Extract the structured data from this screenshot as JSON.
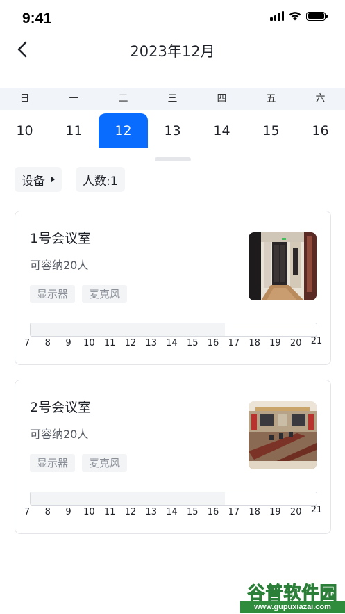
{
  "status_bar": {
    "time": "9:41"
  },
  "header": {
    "title": "2023年12月"
  },
  "calendar": {
    "weekdays": [
      "日",
      "一",
      "二",
      "三",
      "四",
      "五",
      "六"
    ],
    "dates": [
      "10",
      "11",
      "12",
      "13",
      "14",
      "15",
      "16"
    ],
    "selected_date": "12",
    "accent_color": "#0a6cff"
  },
  "filters": {
    "device_label": "设备",
    "people_label": "人数:1"
  },
  "rooms": [
    {
      "name": "1号会议室",
      "capacity": "可容纳20人",
      "tags": [
        "显示器",
        "麦克风"
      ],
      "hours": [
        "7",
        "8",
        "9",
        "10",
        "11",
        "12",
        "13",
        "14",
        "15",
        "16",
        "17",
        "18",
        "19",
        "20",
        "21"
      ],
      "booked_fraction": 0.68
    },
    {
      "name": "2号会议室",
      "capacity": "可容纳20人",
      "tags": [
        "显示器",
        "麦克风"
      ],
      "hours": [
        "7",
        "8",
        "9",
        "10",
        "11",
        "12",
        "13",
        "14",
        "15",
        "16",
        "17",
        "18",
        "19",
        "20",
        "21"
      ],
      "booked_fraction": 0.68
    }
  ],
  "watermark": {
    "title": "谷普软件园",
    "url": "www.gupuxiazai.com"
  }
}
